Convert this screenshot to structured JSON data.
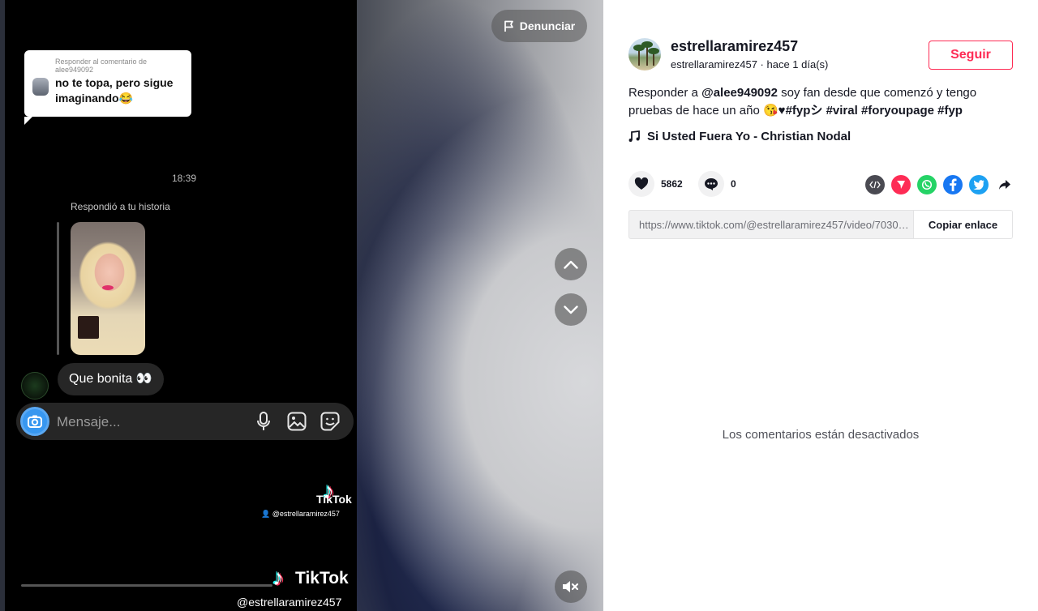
{
  "video": {
    "report_label": "Denunciar",
    "reply": {
      "meta": "Responder al comentario de alee949092",
      "text": "no te topa, pero sigue imaginando😂"
    },
    "chat": {
      "time": "18:39",
      "story_note": "Respondió a tu historia",
      "message": "Que bonita 👀",
      "input_placeholder": "Mensaje..."
    },
    "watermark": {
      "brand": "TikTok",
      "user": "@estrellaramirez457"
    },
    "bottom_watermark": {
      "brand": "TikTok",
      "user": "@estrellaramirez457"
    },
    "progress_fraction": 0.0
  },
  "author": {
    "username": "estrellaramirez457",
    "subline": "estrellaramirez457 · hace 1 día(s)",
    "follow_label": "Seguir"
  },
  "description": {
    "prefix": "Responder a ",
    "mention": "@alee949092",
    "body": " soy fan desde que comenzó y tengo pruebas de hace un año 😘♥",
    "hashtags": "#fypシ #viral #foryoupage #fyp"
  },
  "song": "Si Usted Fuera Yo - Christian Nodal",
  "stats": {
    "likes": "5862",
    "comments": "0"
  },
  "share_icons": [
    "embed-icon",
    "send-icon",
    "whatsapp-icon",
    "facebook-icon",
    "twitter-icon",
    "share-arrow-icon"
  ],
  "colors": {
    "accent": "#fe2c55",
    "whatsapp": "#25d366",
    "facebook": "#1877f2",
    "twitter": "#1da1f2",
    "send": "#fe2c55",
    "embed": "#4a4a52"
  },
  "link": {
    "url": "https://www.tiktok.com/@estrellaramirez457/video/7030000000000000000",
    "copy_label": "Copiar enlace"
  },
  "comments_disabled": "Los comentarios están desactivados"
}
